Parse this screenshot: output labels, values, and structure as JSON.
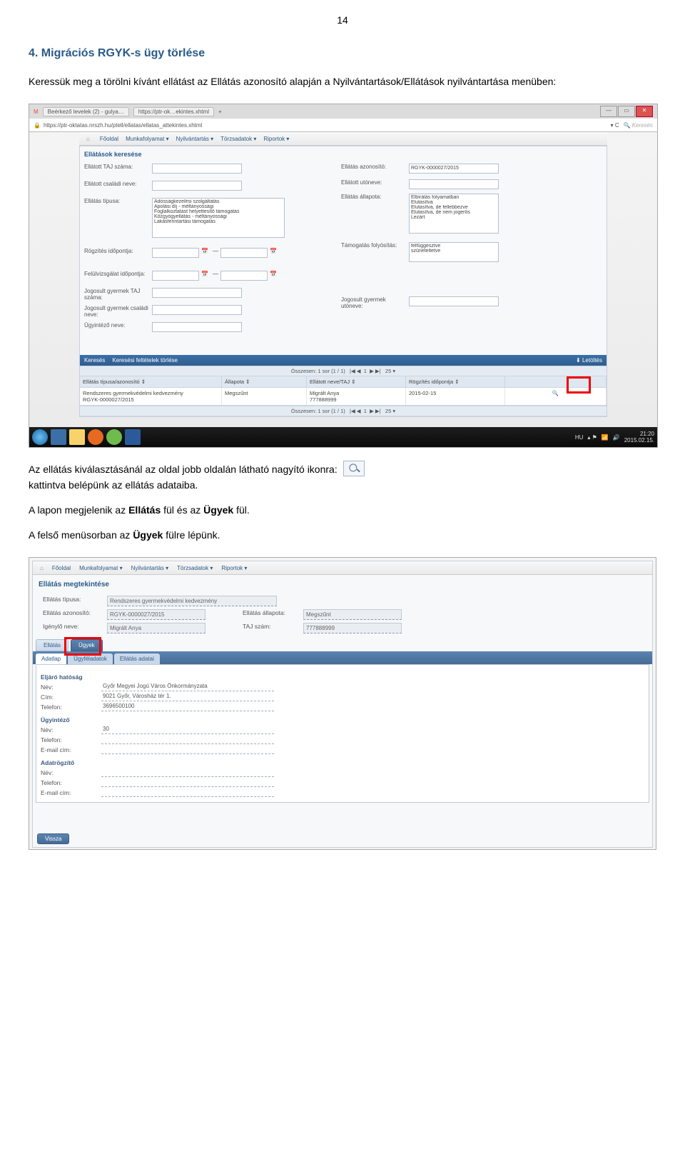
{
  "page_number": "14",
  "heading": "4. Migrációs RGYK-s ügy törlése",
  "intro": "Keressük meg a törölni kívánt ellátást az Ellátás azonosító alapján a Nyilvántartások/Ellátások nyilvántartása menüben:",
  "ss1": {
    "tab1": "Beérkező levelek (2) - gulya…",
    "tab2": "https://ptr-ok…ekintes.xhtml",
    "url": "https://ptr-oktatas.nrszh.hu/ptell/ellatas/ellatas_attekintes.xhtml",
    "search_placeholder": "Keresés",
    "menu": [
      "Főoldal",
      "Munkafolyamat",
      "Nyilvántartás",
      "Törzsadatok",
      "Riportok"
    ],
    "section": "Ellátások keresése",
    "fields": {
      "taj": "Ellátott TAJ száma:",
      "azon": "Ellátás azonosító:",
      "azon_val": "RGYK-0000027/2015",
      "csalad": "Ellátott családi neve:",
      "utonev": "Ellátott utóneve:",
      "tipus": "Ellátás típusa:",
      "tipus_list": [
        "Adósságkezelési szolgáltatás",
        "Ápolási díj - méltányossági",
        "Foglalkoztatást helyettesítő támogatás",
        "Közgyógyellátás - méltányossági",
        "Lakásfenntartási támogatás"
      ],
      "allapot": "Ellátás állapota:",
      "allapot_list": [
        "Elbírálás folyamatban",
        "Elutasítva",
        "Elutasítva, de fellebbezve",
        "Elutasítva, de nem jogerős",
        "Lezárt"
      ],
      "rogz": "Rögzítés időpontja:",
      "tamfoly": "Támogatás folyósítás:",
      "tamfoly_list": [
        "felfüggesztve",
        "szüneteltetve"
      ],
      "feluiv": "Felülvizsgálat időpontja:",
      "jogytaj": "Jogosult gyermek TAJ száma:",
      "jogycs": "Jogosult gyermek családi neve:",
      "jogyu": "Jogosult gyermek utóneve:",
      "ugyint": "Ügyintéző neve:"
    },
    "bluebar_search": "Keresés",
    "bluebar_clear": "Keresési feltételek törlése",
    "bluebar_download": "Letöltés",
    "pager": "Összesen: 1 sor (1 / 1)",
    "pager_size": "25",
    "th": [
      "Ellátás típusa/azonosító ⇕",
      "Állapota ⇕",
      "Ellátott neve/TAJ ⇕",
      "Rögzítés időpontja ⇕",
      ""
    ],
    "row": {
      "c1a": "Rendszeres gyermekvédelmi kedvezmény",
      "c1b": "RGYK-0000027/2015",
      "c2": "Megszűnt",
      "c3a": "Migrált Anya",
      "c3b": "777888999",
      "c4": "2015-02-15"
    },
    "taskbar": {
      "lang": "HU",
      "time": "21:20",
      "date": "2015.02.15."
    }
  },
  "mid1": "Az ellátás kiválasztásánál az oldal jobb oldalán látható nagyító ikonra:",
  "mid2": "kattintva belépünk az ellátás adataiba.",
  "mid3_a": "A lapon megjelenik az ",
  "mid3_b": "Ellátás",
  "mid3_c": " fül és az ",
  "mid3_d": "Ügyek",
  "mid3_e": " fül.",
  "mid4_a": "A felső menüsorban az ",
  "mid4_b": "Ügyek",
  "mid4_c": " fülre lépünk.",
  "ss2": {
    "menu": [
      "Főoldal",
      "Munkafolyamat",
      "Nyilvántartás",
      "Törzsadatok",
      "Riportok"
    ],
    "title": "Ellátás megtekintése",
    "f": {
      "tipus_l": "Ellátás típusa:",
      "tipus_v": "Rendszeres gyermekvédelmi kedvezmény",
      "azon_l": "Ellátás azonosító:",
      "azon_v": "RGYK-0000027/2015",
      "allapot_l": "Ellátás állapota:",
      "allapot_v": "Megszűnt",
      "igeny_l": "Igénylő neve:",
      "igeny_v": "Migrált Anya",
      "taj_l": "TAJ szám:",
      "taj_v": "777888999"
    },
    "tabs": {
      "t1": "Ellátás",
      "t2": "Ügyek"
    },
    "subtabs": {
      "s1": "Adatlap",
      "s2": "Ügyféladatok",
      "s3": "Ellátás adatai"
    },
    "grp1": "Eljáró hatóság",
    "grp1_rows": {
      "nev_l": "Név:",
      "nev_v": "Győr Megyei Jogú Város Önkormányzata",
      "cim_l": "Cím:",
      "cim_v": "9021 Győr, Városház tér 1.",
      "tel_l": "Telefon:",
      "tel_v": "3696500100"
    },
    "grp2": "Ügyintéző",
    "grp2_rows": {
      "nev_l": "Név:",
      "nev_v": "30",
      "tel_l": "Telefon:",
      "email_l": "E-mail cím:"
    },
    "grp3": "Adatrögzítő",
    "grp3_rows": {
      "nev_l": "Név:",
      "tel_l": "Telefon:",
      "email_l": "E-mail cím:"
    },
    "back": "Vissza"
  }
}
